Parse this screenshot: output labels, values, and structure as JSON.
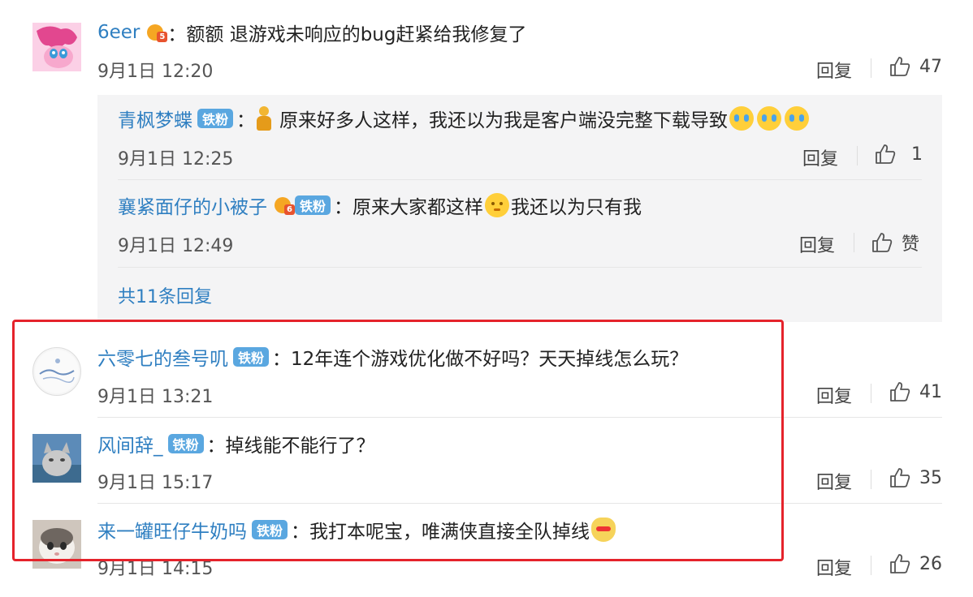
{
  "comments": [
    {
      "user": "6eer",
      "colon": "：",
      "text": "额额 退游戏未响应的bug赶紧给我修复了",
      "time": "9月1日 12:20",
      "reply_label": "回复",
      "like_count": "47",
      "vip_level": "5",
      "replies": [
        {
          "user": "青枫梦蝶",
          "badge": "铁粉",
          "colon": "：",
          "text": "原来好多人这样，我还以为我是客户端没完整下载导致",
          "time": "9月1日 12:25",
          "reply_label": "回复",
          "like_count": "1"
        },
        {
          "user": "襄紧面仔的小被子",
          "badge": "铁粉",
          "vip_level": "6",
          "colon": "：",
          "text_before": "原来大家都这样",
          "text_after": "我还以为只有我",
          "time": "9月1日 12:49",
          "reply_label": "回复",
          "like_label": "赞"
        }
      ],
      "more_replies": "共11条回复"
    },
    {
      "user": "六零七的叁号叽",
      "badge": "铁粉",
      "colon": "：",
      "text": "12年连个游戏优化做不好吗？天天掉线怎么玩？",
      "time": "9月1日 13:21",
      "reply_label": "回复",
      "like_count": "41"
    },
    {
      "user": "风间辞_",
      "badge": "铁粉",
      "colon": "：",
      "text": "掉线能不能行了？",
      "time": "9月1日 15:17",
      "reply_label": "回复",
      "like_count": "35"
    },
    {
      "user": "来一罐旺仔牛奶吗",
      "badge": "铁粉",
      "colon": "：",
      "text": "我打本呢宝，唯满侠直接全队掉线",
      "time": "9月1日 14:15",
      "reply_label": "回复",
      "like_count": "26"
    }
  ],
  "colors": {
    "name": "#2f7fc1",
    "badge": "#5aa7e0",
    "highlight_border": "#e5232b",
    "reply_bg": "#f4f4f5"
  },
  "icons": {
    "like": "thumbs-up-icon",
    "emoji_cry": "crying-laughing-emoji",
    "emoji_shy": "shy-emoji",
    "emoji_doge": "doge-emoji",
    "vip": "vip-crown-icon"
  }
}
